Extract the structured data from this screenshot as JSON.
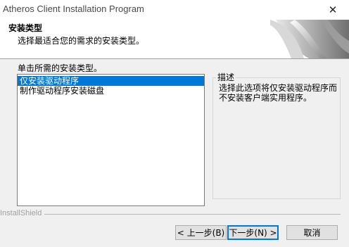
{
  "window": {
    "title": "Atheros Client Installation Program",
    "close_glyph": "✕"
  },
  "header": {
    "title": "安装类型",
    "subtitle": "选择最适合您的需求的安装类型。"
  },
  "main": {
    "prompt": "单击所需的安装类型。",
    "options": [
      {
        "label": "仅安装驱动程序",
        "selected": true
      },
      {
        "label": "制作驱动程序安装磁盘",
        "selected": false
      }
    ],
    "description": {
      "legend": "描述",
      "text": "选择此选项将仅安装驱动程序而不安装客户端实用程序。"
    }
  },
  "footer": {
    "brand": "InstallShield",
    "back_label": "< 上一步(B)",
    "next_label": "下一步(N) >",
    "cancel_label": "取消"
  },
  "colors": {
    "selection": "#0078d7",
    "default_button_border": "#0078d7",
    "background": "#f0f0f0"
  },
  "icons": {
    "close": "close-icon",
    "header_art": "installshield-swoosh-graphic"
  }
}
